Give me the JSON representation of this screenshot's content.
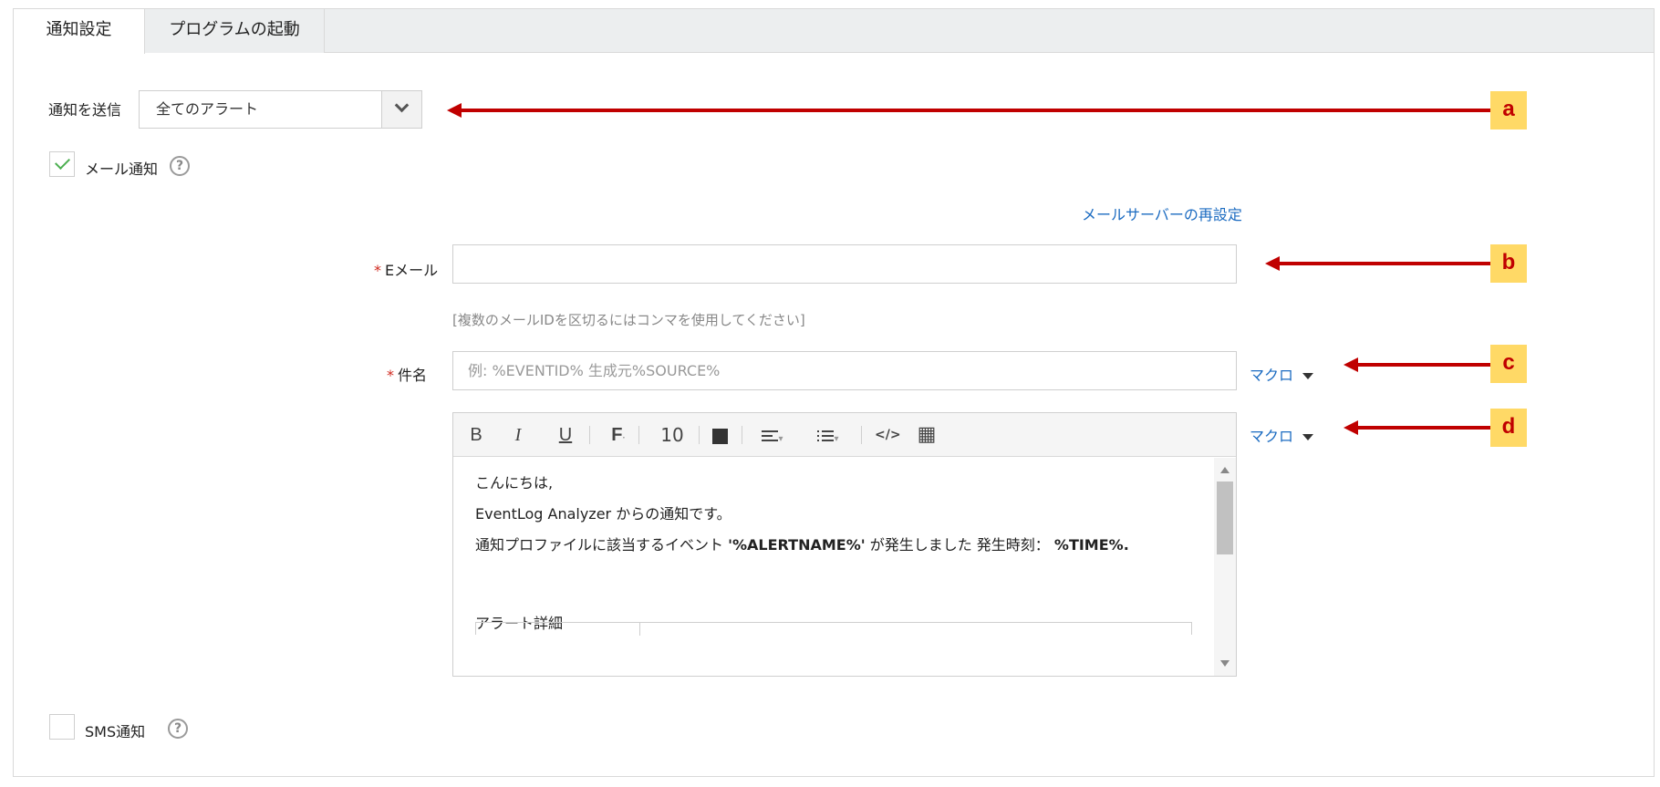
{
  "tabs": [
    {
      "label": "通知設定",
      "active": true
    },
    {
      "label": "プログラムの起動",
      "active": false
    }
  ],
  "send_notification": {
    "label": "通知を送信",
    "selected": "全てのアラート"
  },
  "mail_notification": {
    "label": "メール通知",
    "checked": true,
    "help": "?"
  },
  "reconfigure_mail_server": "メールサーバーの再設定",
  "email": {
    "required_mark": "*",
    "label": "Eメール",
    "value": "",
    "hint": "[複数のメールIDを区切るにはコンマを使用してください]"
  },
  "subject": {
    "required_mark": "*",
    "label": "件名",
    "placeholder": "例: %EVENTID% 生成元%SOURCE%",
    "macro_label": "マクロ"
  },
  "editor": {
    "toolbar": {
      "bold": "B",
      "italic": "I",
      "underline": "U",
      "font": "F",
      "font_caret": "·",
      "font_size": "10",
      "align_caret": "▾",
      "list_caret": "▾",
      "source": "</>",
      "table": "▦"
    },
    "macro_label": "マクロ",
    "greeting": "こんにちは,",
    "line2": "EventLog Analyzer からの通知です。",
    "line3_prefix": "通知プロファイルに該当するイベント",
    "line3_alertname": "'%ALERTNAME%'",
    "line3_mid": "が発生しました 発生時刻：",
    "line3_time": "%TIME%.",
    "alert_details": "アラート詳細"
  },
  "sms_notification": {
    "label": "SMS通知",
    "checked": false,
    "help": "?"
  },
  "annotations": [
    "a",
    "b",
    "c",
    "d"
  ],
  "colors": {
    "accent_link": "#1b6bc1",
    "required": "#d0271d",
    "annotation_arrow": "#c00000",
    "annotation_badge": "#ffd966",
    "check_green": "#4caf50"
  }
}
